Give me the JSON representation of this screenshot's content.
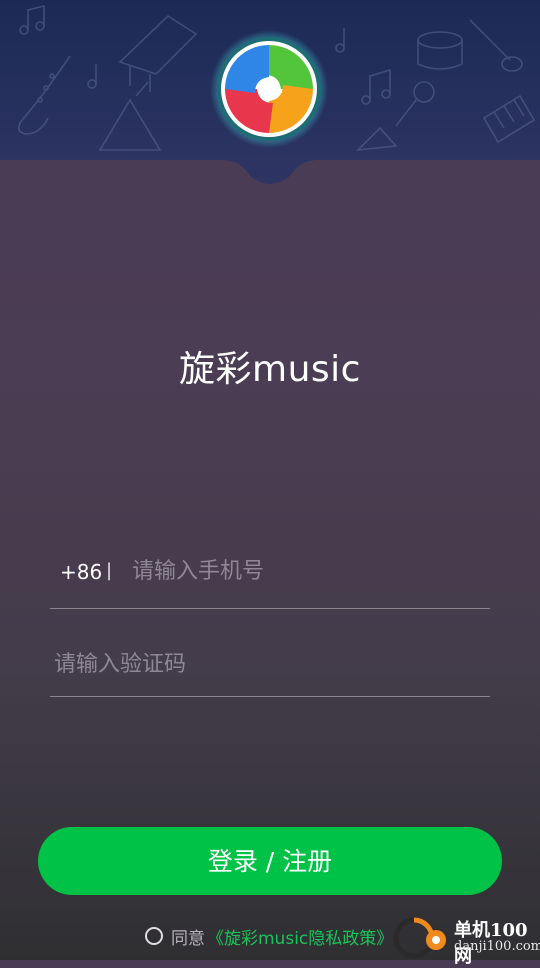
{
  "header": {
    "logo_icon": "colorful-aperture-logo-icon",
    "background_icons": [
      "music-note-icon",
      "piano-icon",
      "saxophone-icon",
      "triangle-icon",
      "microphone-icon",
      "keyboard-icon",
      "drum-icon",
      "guitar-icon"
    ]
  },
  "app": {
    "title": "旋彩music"
  },
  "phone": {
    "country_code": "+86",
    "separator": "|",
    "placeholder": "请输入手机号"
  },
  "verification": {
    "placeholder": "请输入验证码"
  },
  "login": {
    "button_label": "登录 / 注册",
    "accent_color": "#00c247"
  },
  "agreement": {
    "prefix": "同意",
    "policy_link": "《旋彩music隐私政策》",
    "link_color": "#19c35a"
  },
  "watermark": {
    "line1": "单机100网",
    "line2": "danji100.com"
  }
}
